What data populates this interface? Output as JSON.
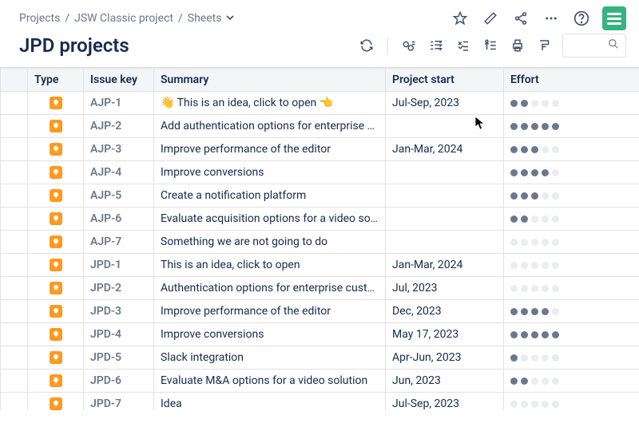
{
  "breadcrumb": {
    "root": "Projects",
    "project": "JSW Classic project",
    "view": "Sheets"
  },
  "page_title": "JPD projects",
  "search": {
    "placeholder": ""
  },
  "columns": {
    "type": "Type",
    "key": "Issue key",
    "summary": "Summary",
    "start": "Project start",
    "effort": "Effort"
  },
  "rows": [
    {
      "key": "AJP-1",
      "summary": "👋 This is an idea, click to open 👈",
      "start": "Jul-Sep, 2023",
      "effort": 2
    },
    {
      "key": "AJP-2",
      "summary": "Add authentication options for enterprise …",
      "start": "",
      "effort": 5
    },
    {
      "key": "AJP-3",
      "summary": "Improve performance of the editor",
      "start": "Jan-Mar, 2024",
      "effort": 3
    },
    {
      "key": "AJP-4",
      "summary": "Improve conversions",
      "start": "",
      "effort": 4
    },
    {
      "key": "AJP-5",
      "summary": "Create a notification platform",
      "start": "",
      "effort": 3
    },
    {
      "key": "AJP-6",
      "summary": "Evaluate acquisition options for a video so…",
      "start": "",
      "effort": 2
    },
    {
      "key": "AJP-7",
      "summary": "Something we are not going to do",
      "start": "",
      "effort": 0
    },
    {
      "key": "JPD-1",
      "summary": "This is an idea, click to open",
      "start": "Jan-Mar, 2024",
      "effort": 0
    },
    {
      "key": "JPD-2",
      "summary": "Authentication options for enterprise cust…",
      "start": "Jul, 2023",
      "effort": 0
    },
    {
      "key": "JPD-3",
      "summary": "Improve performance of the editor",
      "start": "Dec, 2023",
      "effort": 4
    },
    {
      "key": "JPD-4",
      "summary": "Improve conversions",
      "start": "May 17, 2023",
      "effort": 5
    },
    {
      "key": "JPD-5",
      "summary": "Slack integration",
      "start": "Apr-Jun, 2023",
      "effort": 1
    },
    {
      "key": "JPD-6",
      "summary": "Evaluate M&A options for a video solution",
      "start": "Jun, 2023",
      "effort": 2
    },
    {
      "key": "JPD-7",
      "summary": "Idea",
      "start": "Jul-Sep, 2023",
      "effort": 0
    }
  ],
  "effort_max": 5
}
